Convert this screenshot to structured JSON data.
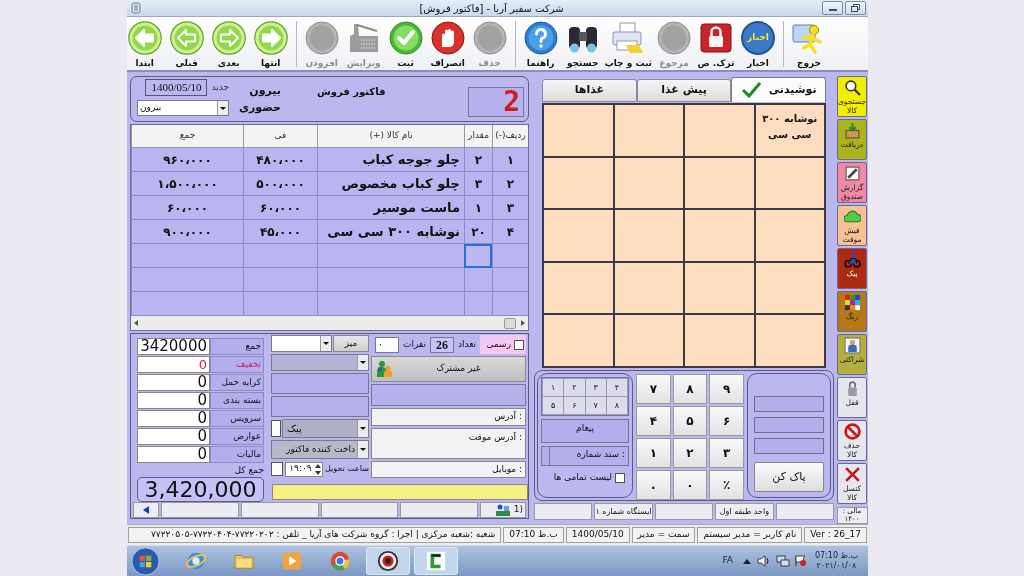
{
  "window": {
    "title": "شرکت سفیر آریا - [فاکتور فروش]"
  },
  "toolbar_groups": [
    {
      "buttons": [
        {
          "label": "خروج",
          "kind": "exit",
          "disabled": false
        }
      ]
    },
    {
      "buttons": [
        {
          "label": "اخبار",
          "kind": "news",
          "icon_text": "اخبار",
          "disabled": false
        },
        {
          "label": "ترک. ص",
          "kind": "lock",
          "disabled": false
        },
        {
          "label": "مرجوع",
          "kind": "return",
          "disabled": true
        },
        {
          "label": "ثبت و چاپ",
          "kind": "print",
          "disabled": false
        },
        {
          "label": "جستجو",
          "kind": "search",
          "disabled": false
        },
        {
          "label": "راهنما",
          "kind": "help",
          "disabled": false
        }
      ]
    },
    {
      "buttons": [
        {
          "label": "حذف",
          "kind": "delete",
          "disabled": true
        },
        {
          "label": "انصراف",
          "kind": "cancel",
          "disabled": false
        },
        {
          "label": "ثبت",
          "kind": "save",
          "disabled": false
        },
        {
          "label": "ویرایش",
          "kind": "edit",
          "disabled": true
        },
        {
          "label": "افزودن",
          "kind": "add",
          "disabled": true
        }
      ]
    },
    {
      "buttons": [
        {
          "label": "انتها",
          "kind": "last",
          "disabled": false
        },
        {
          "label": "بعدی",
          "kind": "next",
          "disabled": false
        },
        {
          "label": "قبلی",
          "kind": "prev",
          "disabled": false
        },
        {
          "label": "ابتدا",
          "kind": "first",
          "disabled": false
        }
      ]
    }
  ],
  "invoice_header": {
    "number": "2",
    "title": "فاکتور فروش",
    "order_type": "بیرون",
    "state": "جدید",
    "date": "1400/05/10",
    "service": "حضوری",
    "location_select": "بیرون"
  },
  "items_table": {
    "columns": [
      "ردیف(-)",
      "مقدار",
      "نام کالا (+)",
      "فی",
      "جمع"
    ],
    "rows": [
      {
        "cells": [
          "۱",
          "۲",
          "چلو جوجه کباب",
          "۴۸۰،۰۰۰",
          "۹۶۰،۰۰۰"
        ]
      },
      {
        "cells": [
          "۲",
          "۳",
          "چلو کباب مخصوص",
          "۵۰۰،۰۰۰",
          "۱،۵۰۰،۰۰۰"
        ]
      },
      {
        "cells": [
          "۳",
          "۱",
          "ماست موسیر",
          "۶۰،۰۰۰",
          "۶۰،۰۰۰"
        ]
      },
      {
        "cells": [
          "۴",
          "۲۰",
          "نوشابه ۳۰۰ سی سی",
          "۴۵،۰۰۰",
          "۹۰۰،۰۰۰"
        ]
      }
    ],
    "entry_row": {
      "cells": [
        {
          "focused": false
        },
        {
          "focused": true
        },
        {
          "focused": false
        },
        {
          "focused": false
        },
        {
          "focused": false
        }
      ]
    }
  },
  "totals": [
    {
      "label": "جمع",
      "value": "3420000",
      "highlighted": false
    },
    {
      "label": "تخفیف",
      "value": "0",
      "highlighted": true
    },
    {
      "label": "کرایه حمل",
      "value": "0",
      "highlighted": false
    },
    {
      "label": "بسته بندی",
      "value": "0",
      "highlighted": false
    },
    {
      "label": "سرویس",
      "value": "0",
      "highlighted": false
    },
    {
      "label": "عوارض",
      "value": "0",
      "highlighted": false
    },
    {
      "label": "مالیات",
      "value": "0",
      "highlighted": false
    }
  ],
  "grand_total": {
    "label": "جمع کل",
    "value": "3,420,000"
  },
  "service_panel": {
    "table_button": "میز",
    "courier_select": {
      "value": "پیک",
      "checked": false
    },
    "payer_select": "داخت کننده فاکتور",
    "delivery_time": {
      "label": "ساعت تحویل",
      "value": "۱۹:۰۹",
      "checked": false
    }
  },
  "customer_panel": {
    "official": {
      "label": "رسمی",
      "checked": false
    },
    "count_label": "تعداد",
    "count": "26",
    "persons_label": "نفرات",
    "persons": "۰",
    "customer_button": "غیر مشترک",
    "address_label": ": آدرس",
    "temp_address_label": ": آدرس موقت",
    "mobile_label": ": موبایل"
  },
  "record_bar": {
    "label": "(1"
  },
  "menu_tabs": [
    {
      "label": "نوشیدنی",
      "selected": true
    },
    {
      "label": "پیش غذا",
      "selected": false
    },
    {
      "label": "غذاها",
      "selected": false
    }
  ],
  "menu_items": [
    {
      "label": "نوشابه ۳۰۰ سی سی"
    }
  ],
  "quick_keys": [
    "۴",
    "۳",
    "۲",
    "۱",
    "۸",
    "۷",
    "۶",
    "۵"
  ],
  "message_label": "پیغام",
  "document_label": ": سند شماره",
  "list_all": {
    "label": "لیست تمامی ها",
    "checked": false
  },
  "keypad": [
    "۹",
    "۸",
    "۷",
    "۶",
    "۵",
    "۴",
    "۳",
    "۲",
    "۱",
    "٪",
    "۰",
    "."
  ],
  "clear_button": "پاک کن",
  "station_bar": [
    "واحد طبقه اول",
    "ایستگاه شماره ۱"
  ],
  "side_buttons": [
    {
      "label": "جستجوی کالا",
      "kind": "search",
      "color": "#f2ee00"
    },
    {
      "label": "دریافت",
      "kind": "receive",
      "color": "#a9b31c"
    },
    {
      "label": "گزارش صندوق",
      "kind": "report",
      "color": "#f08aa2"
    },
    {
      "label": "فیش موقت",
      "kind": "receipt",
      "color": "#f6c296"
    },
    {
      "label": "پیک",
      "kind": "courier",
      "color": "#ad2a12"
    },
    {
      "label": "رنگ",
      "kind": "palette",
      "color": "#b5791a"
    },
    {
      "label": "شراکتی",
      "kind": "member",
      "color": "#b3ae3e"
    },
    {
      "label": "قفل",
      "kind": "lock",
      "color": "#e6e6ee"
    },
    {
      "label": "حذف کالا",
      "kind": "delete",
      "color": "#e6e6ee"
    },
    {
      "label": "کنسل کالا",
      "kind": "cancel",
      "color": "#e6e6ee"
    }
  ],
  "fiscal_year": "مالی : ۱۴۰۰",
  "status_bar": [
    "Ver : 26_17",
    "نام کاربر = مدیر سیستم",
    "سمت = مدیر",
    "1400/05/10",
    "ب.ظ 07:10",
    "شعبه :شعبه مرکزی | اجرا : گروه شرکت های آریا _ تلفن : ۷۷۲۲۰۲۰۲-۷۷۲۲۰۴۰۴-۷۷۲۲۰۵۰۵"
  ],
  "taskbar": {
    "apps": [
      {
        "kind": "browser",
        "running": false
      },
      {
        "kind": "folder",
        "running": false
      },
      {
        "kind": "media",
        "running": false
      },
      {
        "kind": "wheel",
        "running": false
      },
      {
        "kind": "emblem",
        "running": true
      },
      {
        "kind": "letter",
        "running": true
      }
    ],
    "language": "FA",
    "time": "ب.ظ 07:10",
    "date": "۲۰۲۱/۰۱/۰۸"
  }
}
